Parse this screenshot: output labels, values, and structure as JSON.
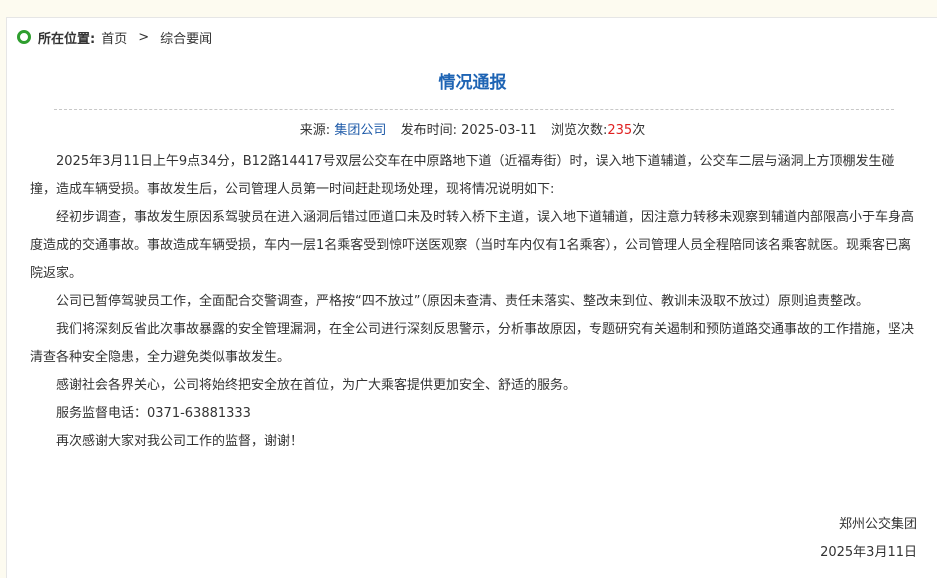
{
  "breadcrumb": {
    "label": "所在位置:",
    "home": "首页",
    "separator": ">",
    "current": "综合要闻"
  },
  "article": {
    "title": "情况通报",
    "meta": {
      "source_label": "来源:",
      "source": "集团公司",
      "date_label": "发布时间:",
      "date": "2025-03-11",
      "views_label": "浏览次数:",
      "views": "235",
      "views_unit": "次"
    },
    "paragraphs": [
      "2025年3月11日上午9点34分，B12路14417号双层公交车在中原路地下道（近福寿街）时，误入地下道辅道，公交车二层与涵洞上方顶棚发生碰撞，造成车辆受损。事故发生后，公司管理人员第一时间赶赴现场处理，现将情况说明如下:",
      "经初步调查，事故发生原因系驾驶员在进入涵洞后错过匝道口未及时转入桥下主道，误入地下道辅道，因注意力转移未观察到辅道内部限高小于车身高度造成的交通事故。事故造成车辆受损，车内一层1名乘客受到惊吓送医观察（当时车内仅有1名乘客），公司管理人员全程陪同该名乘客就医。现乘客已离院返家。",
      "公司已暂停驾驶员工作，全面配合交警调查，严格按“四不放过”（原因未查清、责任未落实、整改未到位、教训未汲取不放过）原则追责整改。",
      "我们将深刻反省此次事故暴露的安全管理漏洞，在全公司进行深刻反思警示，分析事故原因，专题研究有关遏制和预防道路交通事故的工作措施，坚决清查各种安全隐患，全力避免类似事故发生。",
      "感谢社会各界关心，公司将始终把安全放在首位，为广大乘客提供更加安全、舒适的服务。",
      "服务监督电话：0371-63881333",
      "再次感谢大家对我公司工作的监督，谢谢！"
    ],
    "signature": {
      "org": "郑州公交集团",
      "date": "2025年3月11日"
    }
  },
  "colors": {
    "title": "#1e64b4",
    "source_link": "#1e5aa8",
    "views": "#e02020",
    "location_icon": "#2f9e2f",
    "page_bg": "#fdfbf0"
  },
  "icons": {
    "location": "location-dot-icon"
  }
}
